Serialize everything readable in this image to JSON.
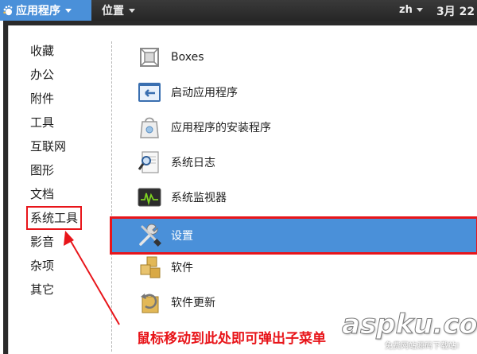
{
  "topbar": {
    "applications_label": "应用程序",
    "places_label": "位置",
    "language": "zh",
    "clock": "3月 22"
  },
  "categories": [
    "收藏",
    "办公",
    "附件",
    "工具",
    "互联网",
    "图形",
    "文档",
    "系统工具",
    "影音",
    "杂项",
    "其它"
  ],
  "highlighted_category": "系统工具",
  "apps": [
    {
      "name": "Boxes",
      "icon": "boxes-icon"
    },
    {
      "name": "启动应用程序",
      "icon": "startup-apps-icon"
    },
    {
      "name": "应用程序的安装程序",
      "icon": "app-installer-icon"
    },
    {
      "name": "系统日志",
      "icon": "system-log-icon"
    },
    {
      "name": "系统监视器",
      "icon": "system-monitor-icon"
    },
    {
      "name": "设置",
      "icon": "settings-tools-icon"
    },
    {
      "name": "软件",
      "icon": "software-icon"
    },
    {
      "name": "软件更新",
      "icon": "software-update-icon"
    }
  ],
  "selected_app": "设置",
  "annotation": {
    "text": "鼠标移动到此处即可弹出子菜单",
    "color": "#e8151a"
  },
  "watermark": {
    "main": "aspku.com",
    "sub": "免费网站源码下载站!"
  },
  "colors": {
    "accent": "#4a90d9",
    "topbar": "#2e2e2e",
    "annotation_red": "#e8151a"
  }
}
